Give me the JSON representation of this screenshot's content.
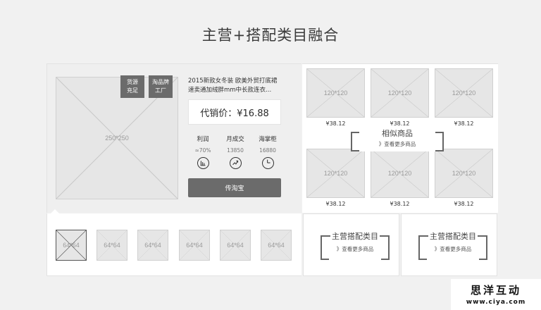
{
  "page": {
    "title": "主营+搭配类目融合"
  },
  "product": {
    "image_label": "250*250",
    "tags": [
      "货源\n充足",
      "淘品牌\n工厂"
    ],
    "title": "2015新款女冬装 欧美外贸打底裙 速卖通加绒胖mm中长款连衣...",
    "price": "代销价：¥16.88",
    "stats": [
      {
        "label": "利润",
        "value": "≈70%",
        "icon": "bar-chart-icon"
      },
      {
        "label": "月成交",
        "value": "13850",
        "icon": "trend-up-icon"
      },
      {
        "label": "海掌柜",
        "value": "16880",
        "icon": "pie-chart-icon"
      }
    ],
    "upload_button": "传淘宝"
  },
  "similar": {
    "title": "相似商品",
    "more": "》查看更多商品",
    "items": [
      {
        "label": "120*120",
        "price": "¥38.12"
      },
      {
        "label": "120*120",
        "price": "¥38.12"
      },
      {
        "label": "120*120",
        "price": "¥38.12"
      },
      {
        "label": "120*120",
        "price": "¥38.12"
      },
      {
        "label": "120*120",
        "price": "¥38.12"
      },
      {
        "label": "120*120",
        "price": "¥38.12"
      }
    ]
  },
  "thumbnails": [
    "64*64",
    "64*64",
    "64*64",
    "64*64",
    "64*64",
    "64*64"
  ],
  "categories": [
    {
      "title": "主营搭配类目",
      "more": "》查看更多商品"
    },
    {
      "title": "主营搭配类目",
      "more": "》查看更多商品"
    }
  ],
  "watermark": {
    "title": "思洋互动",
    "url": "www.ciya.com"
  },
  "colors": {
    "button": "#6b6b6b",
    "placeholder": "#e6e6e6",
    "background": "#f1f1f1"
  }
}
